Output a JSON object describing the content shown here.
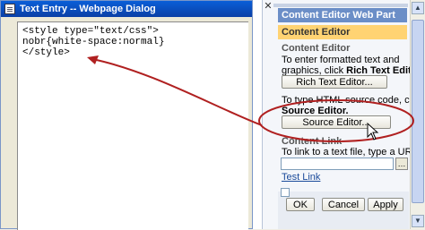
{
  "dialog": {
    "title": "Text Entry -- Webpage Dialog",
    "code_lines": [
      "<style type=\"text/css\">",
      "nobr{white-space:normal}",
      "</style>"
    ]
  },
  "panel": {
    "web_part_title": "Content Editor Web Part",
    "section_title": "Content Editor",
    "content_editor_label": "Content Editor",
    "rich_desc_line1": "To enter formatted text and",
    "rich_desc_line2": "graphics, click",
    "rich_desc_bold": "Rich Text Editor.",
    "rich_button": "Rich Text Editor...",
    "source_desc_line1": "To type HTML source code, click",
    "source_desc_bold": "Source Editor.",
    "source_button": "Source Editor...",
    "content_link_label": "Content Link",
    "link_desc": "To link to a text file, type a URL.",
    "link_value": "",
    "test_link": "Test Link",
    "ok": "OK",
    "cancel": "Cancel",
    "apply": "Apply"
  },
  "colors": {
    "titlebar": "#0a5fd8",
    "web_part_header": "#6b8ec7",
    "section_header": "#ffd373",
    "annotation": "#b02020"
  }
}
